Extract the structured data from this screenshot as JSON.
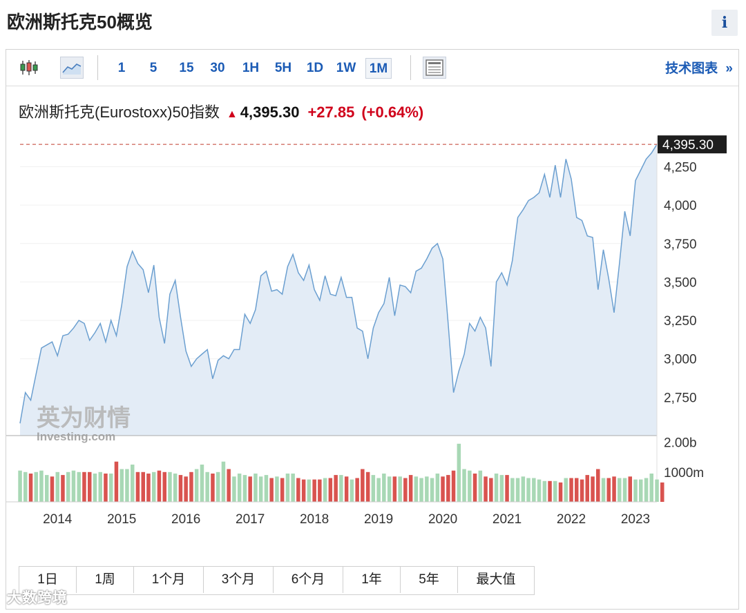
{
  "title": "欧洲斯托克50概览",
  "info_label": "i",
  "toolbar": {
    "timeframes": [
      "1",
      "5",
      "15",
      "30",
      "1H",
      "5H",
      "1D",
      "1W",
      "1M"
    ],
    "selected": "1M",
    "tech_link": "技术图表",
    "tech_arrow": "»"
  },
  "quote": {
    "name": "欧洲斯托克(Eurostoxx)50指数",
    "price": "4,395.30",
    "change": "+27.85",
    "change_pct": "(+0.64%)",
    "direction": "up"
  },
  "range_buttons": [
    "1日",
    "1周",
    "1个月",
    "3个月",
    "6个月",
    "1年",
    "5年",
    "最大值"
  ],
  "watermark_logo": "英为财情 Investing.com",
  "watermark_bottom": "大数跨境",
  "colors": {
    "area_fill": "#e3ecf6",
    "line": "#6b9fd0",
    "up_volume": "#a8d8b5",
    "down_volume": "#d9534f",
    "last_price_line": "#c0392b"
  },
  "chart_data": {
    "type": "area",
    "x_ticks": [
      "2014",
      "2015",
      "2016",
      "2017",
      "2018",
      "2019",
      "2020",
      "2021",
      "2022",
      "2023"
    ],
    "y_ticks": [
      "2,750",
      "3,000",
      "3,250",
      "3,500",
      "3,750",
      "4,000",
      "4,250"
    ],
    "ylim": [
      2500,
      4450
    ],
    "last_price_label": "4,395.30",
    "price_series": {
      "x": [
        "2013-06",
        "2013-07",
        "2013-08",
        "2013-09",
        "2013-10",
        "2013-11",
        "2013-12",
        "2014-01",
        "2014-02",
        "2014-03",
        "2014-04",
        "2014-05",
        "2014-06",
        "2014-07",
        "2014-08",
        "2014-09",
        "2014-10",
        "2014-11",
        "2014-12",
        "2015-01",
        "2015-02",
        "2015-03",
        "2015-04",
        "2015-05",
        "2015-06",
        "2015-07",
        "2015-08",
        "2015-09",
        "2015-10",
        "2015-11",
        "2015-12",
        "2016-01",
        "2016-02",
        "2016-03",
        "2016-04",
        "2016-05",
        "2016-06",
        "2016-07",
        "2016-08",
        "2016-09",
        "2016-10",
        "2016-11",
        "2016-12",
        "2017-01",
        "2017-02",
        "2017-03",
        "2017-04",
        "2017-05",
        "2017-06",
        "2017-07",
        "2017-08",
        "2017-09",
        "2017-10",
        "2017-11",
        "2017-12",
        "2018-01",
        "2018-02",
        "2018-03",
        "2018-04",
        "2018-05",
        "2018-06",
        "2018-07",
        "2018-08",
        "2018-09",
        "2018-10",
        "2018-11",
        "2018-12",
        "2019-01",
        "2019-02",
        "2019-03",
        "2019-04",
        "2019-05",
        "2019-06",
        "2019-07",
        "2019-08",
        "2019-09",
        "2019-10",
        "2019-11",
        "2019-12",
        "2020-01",
        "2020-02",
        "2020-03",
        "2020-04",
        "2020-05",
        "2020-06",
        "2020-07",
        "2020-08",
        "2020-09",
        "2020-10",
        "2020-11",
        "2020-12",
        "2021-01",
        "2021-02",
        "2021-03",
        "2021-04",
        "2021-05",
        "2021-06",
        "2021-07",
        "2021-08",
        "2021-09",
        "2021-10",
        "2021-11",
        "2021-12",
        "2022-01",
        "2022-02",
        "2022-03",
        "2022-04",
        "2022-05",
        "2022-06",
        "2022-07",
        "2022-08",
        "2022-09",
        "2022-10",
        "2022-11",
        "2022-12",
        "2023-01",
        "2023-02",
        "2023-03",
        "2023-04",
        "2023-05"
      ],
      "y": [
        2580,
        2780,
        2730,
        2900,
        3070,
        3090,
        3110,
        3020,
        3150,
        3160,
        3200,
        3250,
        3230,
        3120,
        3170,
        3230,
        3110,
        3250,
        3150,
        3350,
        3600,
        3700,
        3620,
        3580,
        3430,
        3610,
        3270,
        3100,
        3420,
        3510,
        3270,
        3050,
        2950,
        3000,
        3030,
        3060,
        2870,
        2990,
        3020,
        3000,
        3060,
        3060,
        3290,
        3230,
        3320,
        3540,
        3570,
        3440,
        3450,
        3420,
        3600,
        3680,
        3560,
        3510,
        3610,
        3450,
        3380,
        3540,
        3420,
        3410,
        3530,
        3400,
        3400,
        3200,
        3180,
        3000,
        3200,
        3300,
        3360,
        3530,
        3280,
        3480,
        3470,
        3430,
        3570,
        3590,
        3650,
        3720,
        3750,
        3650,
        3230,
        2780,
        2920,
        3030,
        3230,
        3180,
        3270,
        3200,
        2950,
        3500,
        3560,
        3480,
        3640,
        3920,
        3970,
        4030,
        4050,
        4080,
        4200,
        4050,
        4260,
        4050,
        4300,
        4170,
        3920,
        3900,
        3800,
        3790,
        3450,
        3710,
        3520,
        3300,
        3620,
        3960,
        3800,
        4160,
        4230,
        4300,
        4340,
        4395.3
      ]
    },
    "volume_ticks": [
      "2.00b",
      "1000m"
    ],
    "volume_series": {
      "unit": "m",
      "values": [
        1050,
        1000,
        950,
        1000,
        1050,
        900,
        850,
        1000,
        900,
        1000,
        1050,
        1000,
        1000,
        1000,
        950,
        1000,
        950,
        950,
        1350,
        1100,
        1100,
        1250,
        1000,
        1000,
        950,
        1000,
        1050,
        1000,
        1000,
        950,
        900,
        850,
        1000,
        1100,
        1250,
        1000,
        950,
        1000,
        1350,
        1100,
        850,
        950,
        900,
        850,
        950,
        850,
        900,
        800,
        850,
        800,
        950,
        950,
        800,
        750,
        750,
        750,
        750,
        800,
        800,
        900,
        900,
        850,
        750,
        800,
        1100,
        1000,
        900,
        800,
        950,
        850,
        850,
        850,
        800,
        900,
        850,
        800,
        850,
        800,
        950,
        850,
        900,
        1050,
        1950,
        1100,
        1050,
        950,
        1050,
        850,
        800,
        950,
        900,
        900,
        800,
        800,
        850,
        800,
        800,
        750,
        700,
        700,
        700,
        650,
        800,
        800,
        800,
        750,
        900,
        850,
        1100,
        800,
        800,
        850,
        800,
        800,
        850,
        750,
        750,
        800,
        950,
        750,
        650
      ],
      "direction": [
        "u",
        "u",
        "d",
        "u",
        "u",
        "u",
        "d",
        "u",
        "d",
        "u",
        "u",
        "u",
        "d",
        "d",
        "u",
        "u",
        "d",
        "u",
        "d",
        "u",
        "u",
        "u",
        "d",
        "d",
        "d",
        "u",
        "d",
        "d",
        "u",
        "u",
        "d",
        "d",
        "d",
        "u",
        "u",
        "u",
        "d",
        "u",
        "u",
        "d",
        "u",
        "u",
        "u",
        "d",
        "u",
        "u",
        "u",
        "d",
        "u",
        "d",
        "u",
        "u",
        "d",
        "d",
        "u",
        "d",
        "d",
        "u",
        "d",
        "d",
        "u",
        "d",
        "u",
        "d",
        "d",
        "d",
        "u",
        "u",
        "u",
        "u",
        "d",
        "u",
        "d",
        "d",
        "u",
        "u",
        "u",
        "u",
        "u",
        "d",
        "d",
        "d",
        "u",
        "u",
        "u",
        "d",
        "u",
        "d",
        "d",
        "u",
        "u",
        "d",
        "u",
        "u",
        "u",
        "u",
        "u",
        "u",
        "u",
        "d",
        "u",
        "d",
        "u",
        "d",
        "d",
        "d",
        "d",
        "d",
        "d",
        "u",
        "d",
        "d",
        "u",
        "u",
        "d",
        "u",
        "u",
        "u",
        "u",
        "u"
      ]
    }
  }
}
